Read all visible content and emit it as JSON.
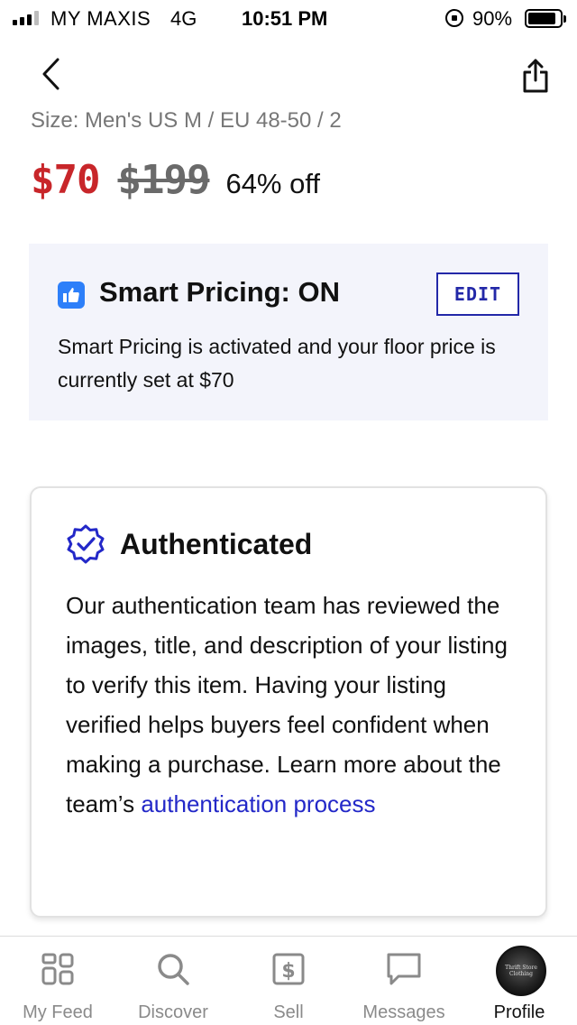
{
  "status_bar": {
    "carrier": "MY MAXIS",
    "network": "4G",
    "time": "10:51 PM",
    "battery": "90%"
  },
  "nav": {
    "back_icon": "chevron-left-icon",
    "share_icon": "share-icon"
  },
  "listing": {
    "size": "Size: Men's US M / EU 48-50 / 2",
    "price_current": "$70",
    "price_original": "$199",
    "discount": "64% off"
  },
  "smart_pricing": {
    "title": "Smart Pricing: ON",
    "edit_label": "EDIT",
    "description": "Smart Pricing is activated and your floor price is currently set at $70",
    "icon": "thumbs-up-icon"
  },
  "authenticated": {
    "title": "Authenticated",
    "body": "Our authentication team has reviewed the images, title, and description of your listing to verify this item. Having your listing verified helps buyers feel confident when making a purchase. Learn more about the team’s ",
    "link_text": "authentication process",
    "icon": "verified-badge-icon"
  },
  "tab_bar": {
    "tabs": [
      {
        "label": "My Feed",
        "icon": "feed-icon"
      },
      {
        "label": "Discover",
        "icon": "search-icon"
      },
      {
        "label": "Sell",
        "icon": "dollar-icon"
      },
      {
        "label": "Messages",
        "icon": "message-icon"
      },
      {
        "label": "Profile",
        "icon": "avatar"
      }
    ],
    "active_tab": "Profile",
    "avatar_text": "Thrift Store Clothing"
  },
  "colors": {
    "price_red": "#c8262a",
    "brand_blue": "#2328a8",
    "link_blue": "#2328c8",
    "thumb_blue": "#2d7ff9",
    "panel_bg": "#f3f4fb"
  }
}
